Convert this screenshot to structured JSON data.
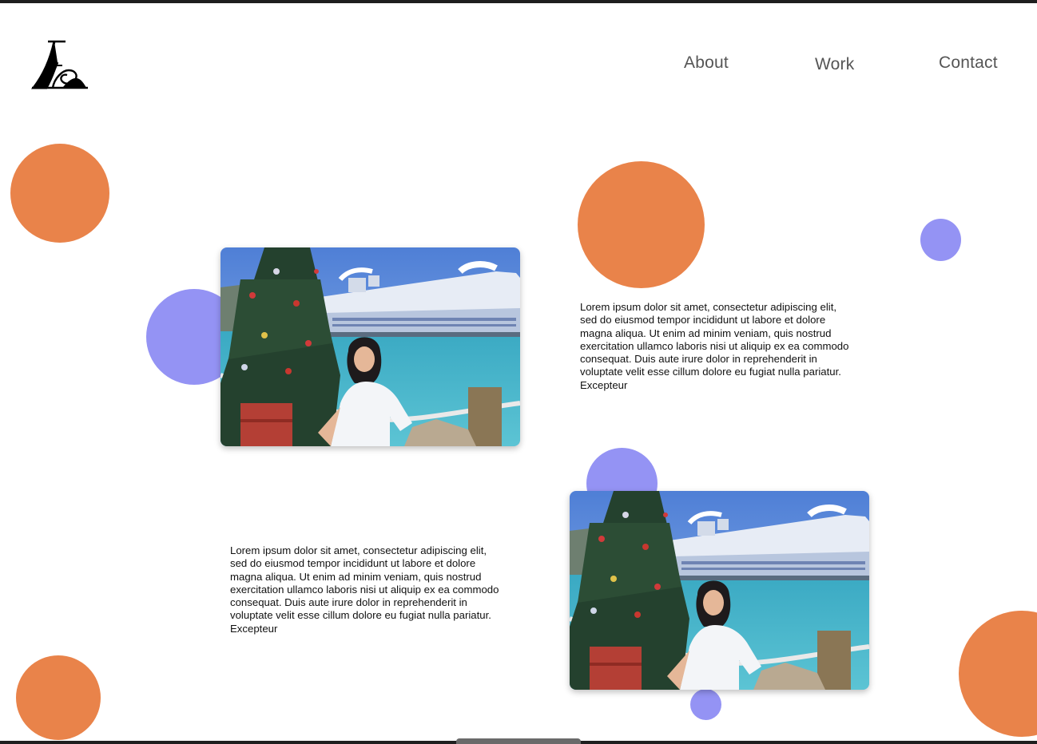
{
  "brand": {
    "logo_icon": "monogram-logo-icon"
  },
  "nav": {
    "items": [
      {
        "label": "About"
      },
      {
        "label": "Work"
      },
      {
        "label": "Contact"
      }
    ]
  },
  "colors": {
    "accent_orange": "#e9834a",
    "accent_violet": "#9493f4",
    "nav_text": "#555555",
    "frame_bar": "#1f1f1f"
  },
  "sections": [
    {
      "image": {
        "semantic": "photo-woman-christmas-tree-cruise-ship"
      },
      "text": "Lorem ipsum dolor sit amet, consectetur adipiscing elit, sed do eiusmod tempor incididunt ut labore et dolore magna aliqua. Ut enim ad minim veniam, quis nostrud exercitation ullamco laboris nisi ut aliquip ex ea commodo consequat. Duis aute irure dolor in reprehenderit in voluptate velit esse cillum dolore eu fugiat nulla pariatur. Excepteur"
    },
    {
      "image": {
        "semantic": "photo-woman-christmas-tree-cruise-ship"
      },
      "text": "Lorem ipsum dolor sit amet, consectetur adipiscing elit, sed do eiusmod tempor incididunt ut labore et dolore magna aliqua. Ut enim ad minim veniam, quis nostrud exercitation ullamco laboris nisi ut aliquip ex ea commodo consequat. Duis aute irure dolor in reprehenderit in voluptate velit esse cillum dolore eu fugiat nulla pariatur. Excepteur"
    }
  ]
}
